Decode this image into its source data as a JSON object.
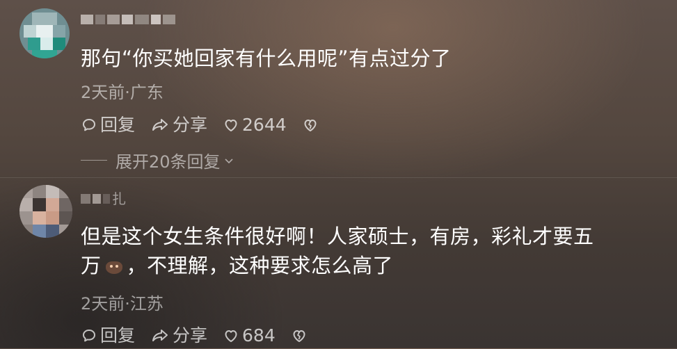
{
  "comments": [
    {
      "text": "那句“你买她回家有什么用呢”有点过分了",
      "time_location": "2天前·广东",
      "reply_label": "回复",
      "share_label": "分享",
      "likes": "2644",
      "expand_label": "展开20条回复"
    },
    {
      "username": "扎",
      "text_line1": "但是这个女生条件很好啊！人家硕士，有房，彩礼才要五",
      "text_line2_before_emoji": "万",
      "text_line2_after_emoji": "，不理解，这种要求怎么高了",
      "time_location": "2天前·江苏",
      "reply_label": "回复",
      "share_label": "分享",
      "likes": "684"
    }
  ],
  "icons": {
    "reply": "comment-bubble-icon",
    "share": "share-arrow-icon",
    "like": "heart-icon",
    "dislike": "broken-heart-icon",
    "expand": "chevron-down-icon"
  },
  "colors": {
    "background": "#54473f",
    "text_primary": "#ffffff",
    "text_secondary": "#a9a19c"
  }
}
